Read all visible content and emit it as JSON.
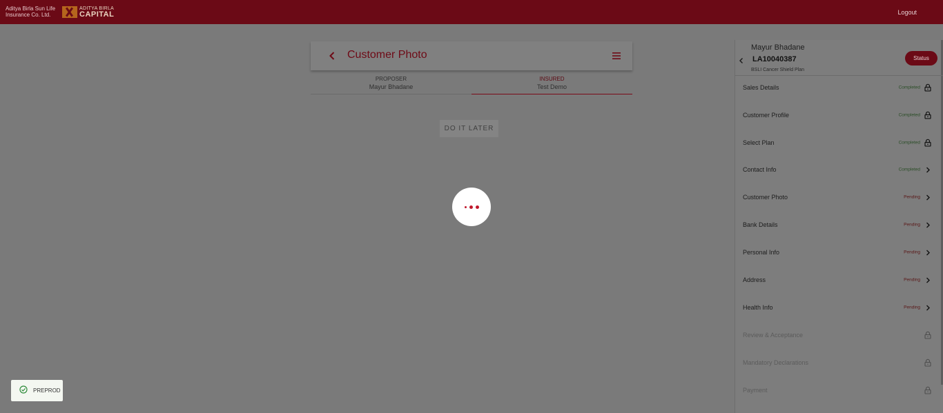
{
  "header": {
    "brand_line1": "Aditya Birla Sun Life",
    "brand_line2": "Insurance Co. Ltd.",
    "logo_line1": "ADITYA BIRLA",
    "logo_line2": "CAPITAL",
    "logout_label": "Logout"
  },
  "page": {
    "title": "Customer Photo",
    "back_icon": "chevron-left-icon",
    "menu_icon": "hamburger-menu-icon"
  },
  "tabs": [
    {
      "role": "PROPOSER",
      "name": "Mayur Bhadane",
      "active": false
    },
    {
      "role": "INSURED",
      "name": "Test Demo",
      "active": true
    }
  ],
  "actions": {
    "do_it_later_label": "DO IT LATER"
  },
  "env_badge": {
    "label": "PREPROD",
    "icon": "check-circle-icon"
  },
  "sidebar": {
    "customer_name": "Mayur Bhadane",
    "application_no": "LA10040387",
    "plan_name": "BSLI Cancer Shield Plan",
    "status_label": "Status",
    "items": [
      {
        "label": "Sales Details",
        "status": "Completed",
        "icon": "lock-icon",
        "state": "done"
      },
      {
        "label": "Customer Profile",
        "status": "Completed",
        "icon": "lock-icon",
        "state": "done"
      },
      {
        "label": "Select Plan",
        "status": "Completed",
        "icon": "lock-icon",
        "state": "done"
      },
      {
        "label": "Contact Info",
        "status": "Completed",
        "icon": "chevron-right-icon",
        "state": "done"
      },
      {
        "label": "Customer Photo",
        "status": "Pending",
        "icon": "chevron-right-icon",
        "state": "pending"
      },
      {
        "label": "Bank Details",
        "status": "Pending",
        "icon": "chevron-right-icon",
        "state": "pending"
      },
      {
        "label": "Personal Info",
        "status": "Pending",
        "icon": "chevron-right-icon",
        "state": "pending"
      },
      {
        "label": "Address",
        "status": "Pending",
        "icon": "chevron-right-icon",
        "state": "pending"
      },
      {
        "label": "Health Info",
        "status": "Pending",
        "icon": "chevron-right-icon",
        "state": "pending"
      },
      {
        "label": "Review & Acceptance",
        "status": "",
        "icon": "lock-icon",
        "state": "disabled"
      },
      {
        "label": "Mandatory Declarations",
        "status": "",
        "icon": "lock-icon",
        "state": "disabled"
      },
      {
        "label": "Payment",
        "status": "",
        "icon": "lock-icon",
        "state": "disabled"
      }
    ]
  },
  "colors": {
    "brand": "#6b0a16",
    "accent": "#c0182c",
    "overlay": "#7a7a7a"
  }
}
